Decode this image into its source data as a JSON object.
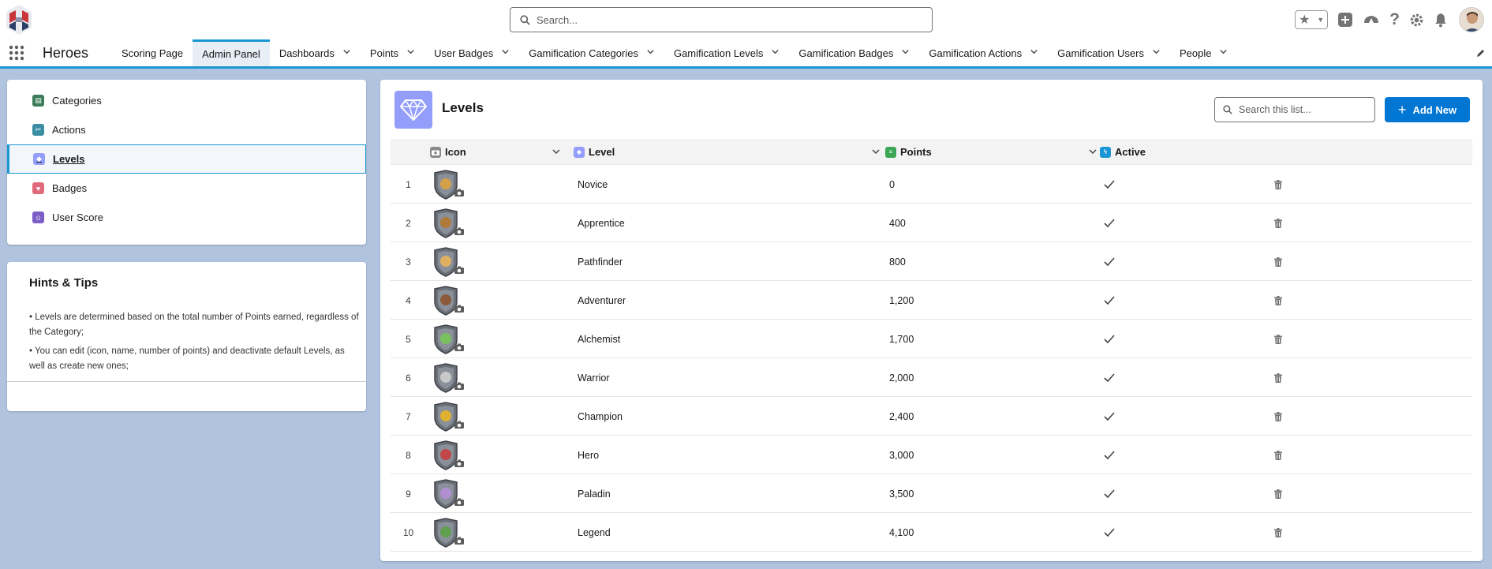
{
  "header": {
    "search_placeholder": "Search..."
  },
  "nav": {
    "app_name": "Heroes",
    "items": [
      {
        "label": "Scoring Page",
        "dropdown": false,
        "active": false
      },
      {
        "label": "Admin Panel",
        "dropdown": false,
        "active": true
      },
      {
        "label": "Dashboards",
        "dropdown": true,
        "active": false
      },
      {
        "label": "Points",
        "dropdown": true,
        "active": false
      },
      {
        "label": "User Badges",
        "dropdown": true,
        "active": false
      },
      {
        "label": "Gamification Categories",
        "dropdown": true,
        "active": false
      },
      {
        "label": "Gamification Levels",
        "dropdown": true,
        "active": false
      },
      {
        "label": "Gamification Badges",
        "dropdown": true,
        "active": false
      },
      {
        "label": "Gamification Actions",
        "dropdown": true,
        "active": false
      },
      {
        "label": "Gamification Users",
        "dropdown": true,
        "active": false
      },
      {
        "label": "People",
        "dropdown": true,
        "active": false
      }
    ]
  },
  "sidebar": {
    "items": [
      {
        "label": "Categories",
        "icon": "categories-icon",
        "color": "#3b7c5a"
      },
      {
        "label": "Actions",
        "icon": "actions-icon",
        "color": "#3a8fa5"
      },
      {
        "label": "Levels",
        "icon": "diamond-icon",
        "color": "#939dfa",
        "selected": true
      },
      {
        "label": "Badges",
        "icon": "badge-icon",
        "color": "#e06a7a"
      },
      {
        "label": "User Score",
        "icon": "user-score-icon",
        "color": "#7b5fc7"
      }
    ]
  },
  "tips": {
    "title": "Hints & Tips",
    "items": [
      "• Levels are determined based on the total number of Points earned, regardless of the Category;",
      "• You can edit (icon, name, number of points) and deactivate default Levels, as well as create new ones;"
    ]
  },
  "list": {
    "title": "Levels",
    "search_placeholder": "Search this list...",
    "add_label": "Add New",
    "columns": {
      "icon": "Icon",
      "level": "Level",
      "points": "Points",
      "active": "Active"
    },
    "rows": [
      {
        "num": "1",
        "level": "Novice",
        "points": "0",
        "active": true,
        "emblem": "#d4a04a"
      },
      {
        "num": "2",
        "level": "Apprentice",
        "points": "400",
        "active": true,
        "emblem": "#b07a3a"
      },
      {
        "num": "3",
        "level": "Pathfinder",
        "points": "800",
        "active": true,
        "emblem": "#e0b060"
      },
      {
        "num": "4",
        "level": "Adventurer",
        "points": "1,200",
        "active": true,
        "emblem": "#8a5a3a"
      },
      {
        "num": "5",
        "level": "Alchemist",
        "points": "1,700",
        "active": true,
        "emblem": "#7ac060"
      },
      {
        "num": "6",
        "level": "Warrior",
        "points": "2,000",
        "active": true,
        "emblem": "#c8c8c8"
      },
      {
        "num": "7",
        "level": "Champion",
        "points": "2,400",
        "active": true,
        "emblem": "#e0b030"
      },
      {
        "num": "8",
        "level": "Hero",
        "points": "3,000",
        "active": true,
        "emblem": "#c04848"
      },
      {
        "num": "9",
        "level": "Paladin",
        "points": "3,500",
        "active": true,
        "emblem": "#b090d0"
      },
      {
        "num": "10",
        "level": "Legend",
        "points": "4,100",
        "active": true,
        "emblem": "#60a050"
      }
    ]
  },
  "colors": {
    "brand_blue": "#0176d3",
    "nav_accent": "#1b96d5",
    "levels_purple": "#939dfa"
  }
}
